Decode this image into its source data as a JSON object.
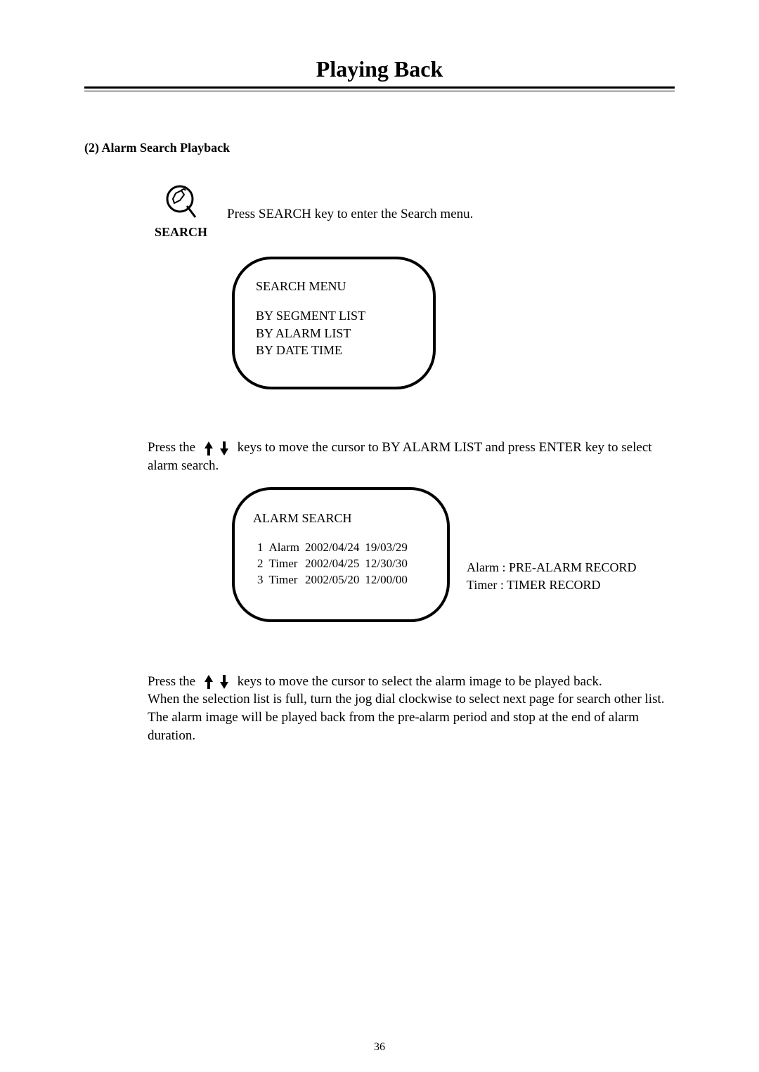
{
  "header": {
    "title": "Playing Back"
  },
  "section": {
    "heading": "(2) Alarm  Search Playback",
    "search": {
      "label": "SEARCH",
      "instruction": "Press SEARCH key to enter the Search menu.",
      "icon_name": "search-key-icon"
    },
    "search_menu": {
      "title": "SEARCH  MENU",
      "items": [
        "BY   SEGMENT  LIST",
        "BY   ALARM   LIST",
        "BY   DATE   TIME"
      ]
    },
    "alarm_instruction_pre": "Press the ",
    "alarm_instruction_post": " keys to move the cursor to BY ALARM  LIST and press ENTER key to select alarm search.",
    "alarm_search": {
      "title": "ALARM  SEARCH",
      "rows": [
        {
          "idx": "1",
          "type": "Alarm",
          "date": "2002/04/24",
          "time": "19/03/29"
        },
        {
          "idx": "2",
          "type": "Timer",
          "date": "2002/04/25",
          "time": "12/30/30"
        },
        {
          "idx": "3",
          "type": "Timer",
          "date": "2002/05/20",
          "time": "12/00/00"
        }
      ]
    },
    "legend": {
      "alarm": "Alarm : PRE-ALARM RECORD",
      "timer": "Timer : TIMER RECORD"
    },
    "final_pre": "Press the ",
    "final_post_line1": " keys to move the cursor to select the alarm image to be played back.",
    "final_line2": "When the selection list is full, turn the jog dial clockwise to select next page for search other list.",
    "final_line3": "The alarm image will be played back from the pre-alarm period and stop at the end of alarm duration."
  },
  "page_number": "36"
}
